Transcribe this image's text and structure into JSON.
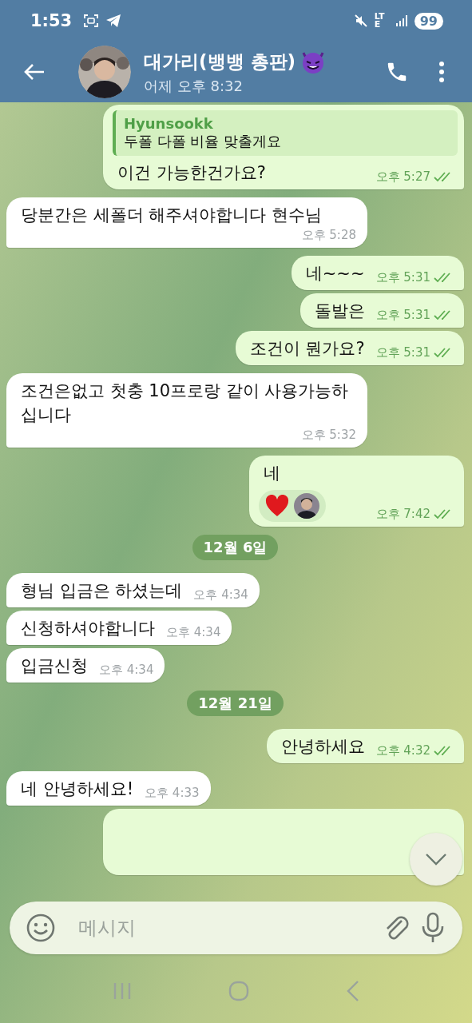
{
  "status_bar": {
    "time": "1:53",
    "network": "LTE",
    "battery": "99"
  },
  "header": {
    "title": "대가리(뱅뱅 총판)",
    "subtitle": "어제 오후 8:32"
  },
  "messages": [
    {
      "kind": "out",
      "reply": {
        "author": "Hyunsookk",
        "text": "두폴 다폴 비율 맞출게요"
      },
      "text": "이건 가능한건가요?",
      "time": "오후 5:27",
      "read": true
    },
    {
      "kind": "in",
      "text": "당분간은 세폴더 해주셔야합니다 현수님",
      "time": "오후 5:28"
    },
    {
      "kind": "out",
      "text": "네~~~",
      "time": "오후 5:31",
      "read": true
    },
    {
      "kind": "out",
      "text": "돌발은",
      "time": "오후 5:31",
      "read": true
    },
    {
      "kind": "out",
      "text": "조건이 뭔가요?",
      "time": "오후 5:31",
      "read": true
    },
    {
      "kind": "in",
      "text": "조건은없고 첫충 10프로랑 같이 사용가능하십니다",
      "time": "오후 5:32"
    },
    {
      "kind": "out",
      "text": "네",
      "time": "오후 7:42",
      "read": true,
      "reaction": true
    },
    {
      "kind": "date",
      "text": "12월 6일"
    },
    {
      "kind": "in",
      "text": "형님 입금은 하셨는데",
      "time": "오후 4:34"
    },
    {
      "kind": "in",
      "text": "신청하셔야합니다",
      "time": "오후 4:34"
    },
    {
      "kind": "in",
      "text": "입금신청",
      "time": "오후 4:34"
    },
    {
      "kind": "date",
      "text": "12월 21일"
    },
    {
      "kind": "out",
      "text": "안녕하세요",
      "time": "오후 4:32",
      "read": true
    },
    {
      "kind": "in",
      "text": "네 안녕하세요!",
      "time": "오후 4:33"
    },
    {
      "kind": "hidden"
    }
  ],
  "composer": {
    "placeholder": "메시지"
  }
}
